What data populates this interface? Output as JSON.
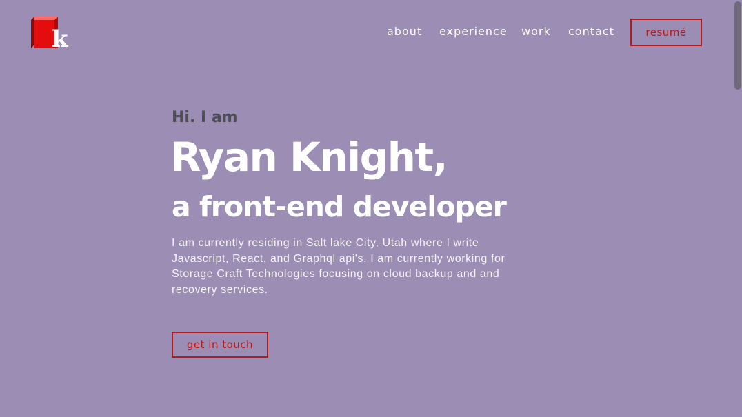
{
  "logo": {
    "letter": "k",
    "icon": "red-cube-logo-icon"
  },
  "nav": {
    "links": [
      "about",
      "experience",
      "work",
      "contact"
    ],
    "resume_label": "resumé"
  },
  "hero": {
    "greeting": "Hi. I am",
    "name": "Ryan Knight,",
    "role": "a front-end developer",
    "bio_lines": [
      "I am currently residing in Salt lake City, Utah where I write",
      "Javascript, React, and Graphql api's. I am currently working for",
      "Storage Craft Technologies focusing on cloud backup and and",
      "recovery services."
    ],
    "cta_label": "get in touch"
  },
  "colors": {
    "background": "#9b8db3",
    "accent": "#b51919",
    "greeting": "#4e4e57",
    "heading": "#ffffff"
  },
  "scrollbar": {
    "position": 0
  }
}
